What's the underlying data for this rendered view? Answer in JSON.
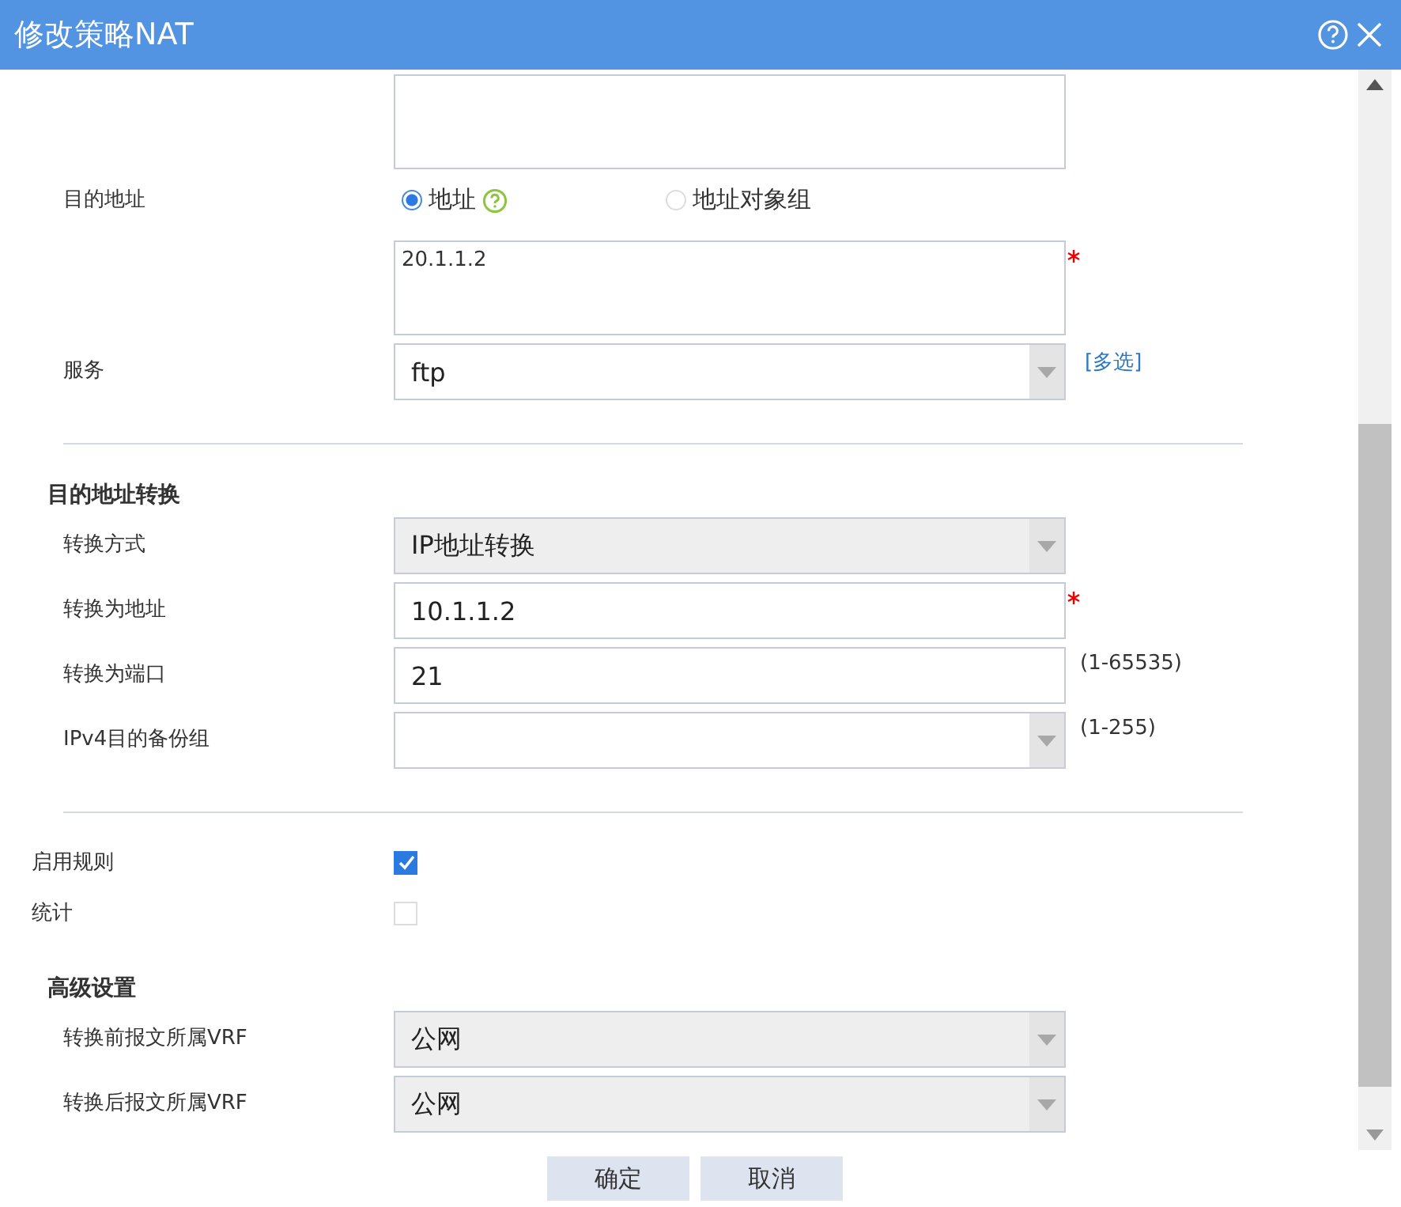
{
  "window": {
    "title": "修改策略NAT"
  },
  "form": [
    {
      "kind": "textarea"
    },
    {
      "kind": "radio",
      "label": "目的地址",
      "options": [
        {
          "label": "地址",
          "selected": true,
          "help": true
        },
        {
          "label": "地址对象组",
          "selected": false,
          "help": false
        }
      ]
    },
    {
      "kind": "textarea",
      "value": "20.1.1.2",
      "required": true
    },
    {
      "kind": "select",
      "label": "服务",
      "value": "ftp",
      "link": "[多选]",
      "filled": false
    },
    {
      "kind": "divider"
    },
    {
      "kind": "heading",
      "label": "目的地址转换"
    },
    {
      "kind": "select",
      "label": "转换方式",
      "value": "IP地址转换",
      "filled": true
    },
    {
      "kind": "input",
      "label": "转换为地址",
      "value": "10.1.1.2",
      "required": true
    },
    {
      "kind": "input",
      "label": "转换为端口",
      "value": "21",
      "hint": "(1-65535)"
    },
    {
      "kind": "select",
      "label": "IPv4目的备份组",
      "hint": "(1-255)",
      "filled": false
    },
    {
      "kind": "divider"
    },
    {
      "kind": "checkbox",
      "label": "启用规则",
      "checked": true
    },
    {
      "kind": "checkbox",
      "label": "统计",
      "checked": false
    },
    {
      "kind": "heading",
      "label": "高级设置"
    },
    {
      "kind": "select",
      "label": "转换前报文所属VRF",
      "value": "公网",
      "filled": true
    },
    {
      "kind": "select",
      "label": "转换后报文所属VRF",
      "value": "公网",
      "filled": true
    }
  ],
  "buttons": [
    "确定",
    "取消"
  ]
}
